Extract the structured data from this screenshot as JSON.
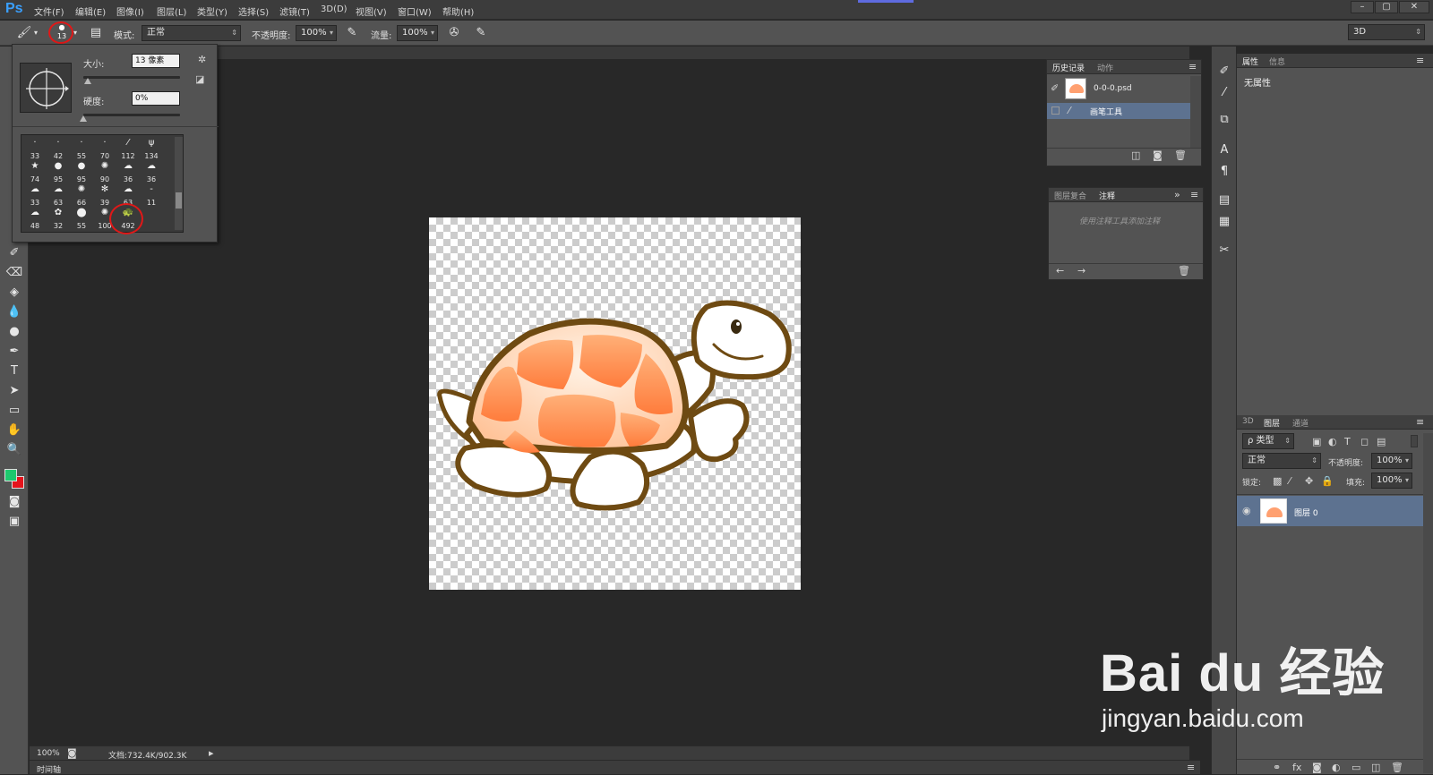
{
  "app": {
    "logo": "Ps",
    "menus": [
      "文件(F)",
      "编辑(E)",
      "图像(I)",
      "图层(L)",
      "类型(Y)",
      "选择(S)",
      "滤镜(T)",
      "3D(D)",
      "视图(V)",
      "窗口(W)",
      "帮助(H)"
    ],
    "window_buttons": [
      "–",
      "▢",
      "✕"
    ]
  },
  "options_bar": {
    "brush_size": "13",
    "mode_label": "模式:",
    "mode_value": "正常",
    "opacity_label": "不透明度:",
    "opacity_value": "100%",
    "flow_label": "流量:",
    "flow_value": "100%",
    "workspace": "3D"
  },
  "brush_picker": {
    "size_label": "大小:",
    "size_value": "13 像素",
    "hardness_label": "硬度:",
    "hardness_value": "0%",
    "presets": [
      "33",
      "42",
      "55",
      "70",
      "112",
      "134",
      "74",
      "95",
      "95",
      "90",
      "36",
      "36",
      "33",
      "63",
      "66",
      "39",
      "63",
      "11",
      "48",
      "32",
      "55",
      "100",
      "492"
    ]
  },
  "history_panel": {
    "tabs": [
      "历史记录",
      "动作"
    ],
    "items": [
      "0-0-0.psd",
      "画笔工具"
    ]
  },
  "notes_panel": {
    "tabs": [
      "图层复合",
      "注释"
    ],
    "placeholder": "使用注释工具添加注释"
  },
  "properties_panel": {
    "tabs": [
      "属性",
      "信息"
    ],
    "content": "无属性"
  },
  "layers_panel": {
    "tabs": [
      "3D",
      "图层",
      "通道"
    ],
    "filter": "ρ 类型",
    "blend": "正常",
    "opacity_label": "不透明度:",
    "opacity_value": "100%",
    "lock_label": "锁定:",
    "fill_label": "填充:",
    "fill_value": "100%",
    "layer_name": "图层 0"
  },
  "status": {
    "zoom": "100%",
    "doc_size": "文档:732.4K/902.3K",
    "timeline": "时间轴"
  },
  "watermark": {
    "brand": "Bai du 经验",
    "url": "jingyan.baidu.com"
  },
  "colors": {
    "foreground": "#1ec86e",
    "background": "#e4141c",
    "annotation": "#e01818"
  }
}
